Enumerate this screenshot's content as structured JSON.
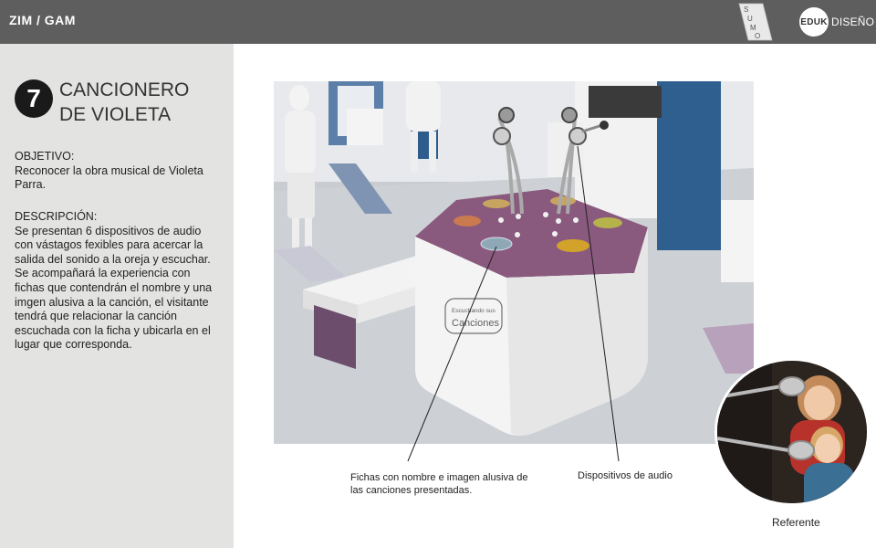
{
  "header": {
    "title": "ZIM / GAM",
    "sumo_letters": [
      "S",
      "U",
      "M",
      "O"
    ],
    "eduk_badge": "EDUK",
    "eduk_text": "DISEÑO"
  },
  "sidebar": {
    "number": "7",
    "title_line1": "CANCIONERO",
    "title_line2": "DE VIOLETA",
    "objective_label": "OBJETIVO:",
    "objective_text": "Reconocer la obra musical de Violeta Parra.",
    "description_label": "DESCRIPCIÓN:",
    "description_text": "Se presentan 6 dispositivos de audio con vástagos fexibles para acercar la salida del sonido a la oreja y escuchar. Se acompañará la experiencia con fichas que contendrán el nombre y una imgen alusiva a la canción, el visitante tendrá que relacionar la canción escuchada con la ficha y ubicarla en el lugar que corresponda."
  },
  "render": {
    "kiosk_label_small": "Escuchando sus",
    "kiosk_label_big": "Canciones"
  },
  "captions": {
    "fichas": "Fichas con nombre e imagen alusiva de las canciones presentadas.",
    "audio": "Dispositivos de audio",
    "referente": "Referente"
  },
  "colors": {
    "topbar": "#5e5e5e",
    "sidebar": "#e3e3e2",
    "kiosk_top": "#8a5a7e"
  }
}
